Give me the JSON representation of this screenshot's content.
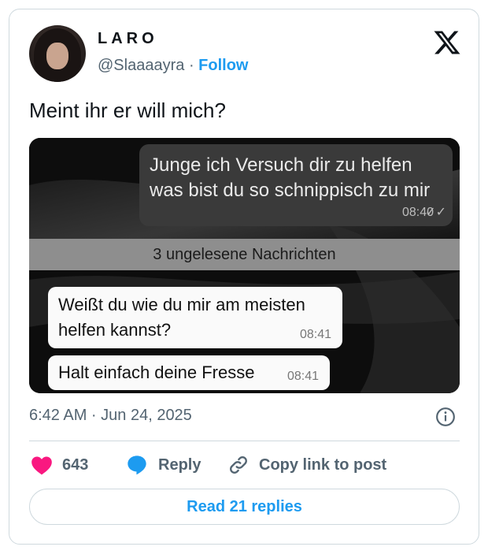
{
  "author": {
    "display_name": "LARO",
    "handle": "@Slaaaayra",
    "separator": "·",
    "follow_label": "Follow"
  },
  "post": {
    "text": "Meint ihr er will mich?",
    "timestamp": "6:42 AM · Jun 24, 2025"
  },
  "chat": {
    "outgoing": {
      "line1": "Junge ich Versuch dir zu helfen",
      "line2": "was bist du so schnippisch zu mir",
      "time": "08:40"
    },
    "unread_banner": "3 ungelesene Nachrichten",
    "incoming": [
      {
        "line1": "Weißt du wie du mir am meisten",
        "line2": "helfen kannst?",
        "time": "08:41"
      },
      {
        "line1": "Halt einfach deine Fresse",
        "time": "08:41"
      }
    ]
  },
  "actions": {
    "like_count": "643",
    "reply_label": "Reply",
    "copy_label": "Copy link to post",
    "read_replies_label": "Read 21 replies"
  },
  "colors": {
    "like": "#f91880",
    "accent": "#1d9bf0",
    "muted": "#536471"
  },
  "icons": [
    "x-logo-icon",
    "heart-icon",
    "reply-bubble-icon",
    "link-icon",
    "info-icon"
  ]
}
